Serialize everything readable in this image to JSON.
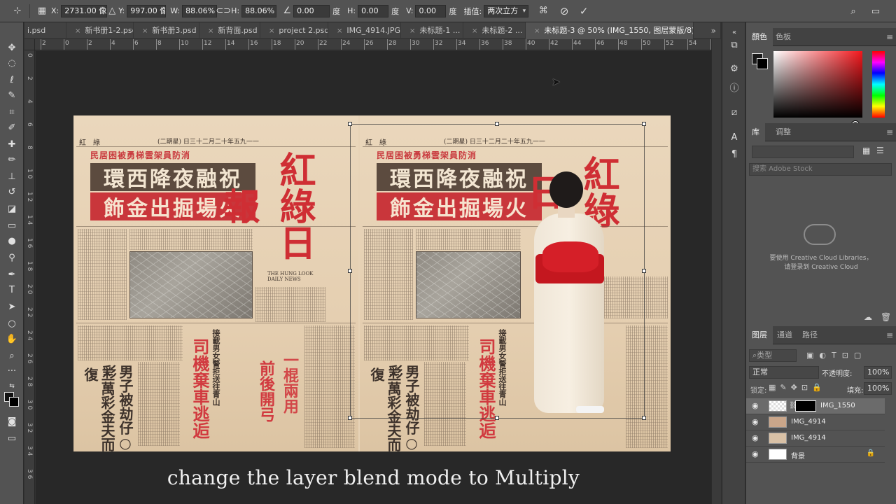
{
  "options_bar": {
    "x_label": "X:",
    "x_value": "2731.00 像素",
    "y_label": "Y:",
    "y_value": "997.00 像素",
    "w_label": "W:",
    "w_value": "88.06%",
    "h_label": "H:",
    "h_value": "88.06%",
    "angle_value": "0.00",
    "angle_unit": "度",
    "skew_h_label": "H:",
    "skew_h_value": "0.00",
    "skew_h_unit": "度",
    "skew_v_label": "V:",
    "skew_v_value": "0.00",
    "skew_v_unit": "度",
    "interp_label": "插值:",
    "interp_value": "两次立方"
  },
  "tabs": [
    {
      "label": "i.psd"
    },
    {
      "label": "新书册1-2.psd"
    },
    {
      "label": "新书册3.psd"
    },
    {
      "label": "新背面.psd"
    },
    {
      "label": "project 2.psd"
    },
    {
      "label": "IMG_4914.JPG"
    },
    {
      "label": "未标题-1 ..."
    },
    {
      "label": "未标题-2 ..."
    },
    {
      "label": "未标题-3 @ 50% (IMG_1550, 图层蒙版/8) *"
    }
  ],
  "tab_overflow": "»",
  "ruler": {
    "top_labels": [
      "2",
      "0",
      "2",
      "4",
      "6",
      "8",
      "10",
      "12",
      "14",
      "16",
      "18",
      "20",
      "22",
      "24",
      "26",
      "28",
      "30",
      "32",
      "34",
      "36",
      "38",
      "40",
      "42",
      "44",
      "46",
      "48",
      "50",
      "52",
      "54",
      "56"
    ],
    "left_labels": [
      "0",
      "2",
      "4",
      "6",
      "8",
      "1 0",
      "1 2",
      "1 4",
      "1 6",
      "1 8",
      "2 0",
      "2 2",
      "2 4",
      "2 6",
      "2 8",
      "3 0",
      "3 2",
      "3 4",
      "3 6"
    ]
  },
  "newspaper": {
    "masthead": "紅綠日報",
    "masthead_left": "紅綠日",
    "masthead_right": "紅綠日",
    "masthead_right_last": "報",
    "top_right_header": "紅　綠",
    "date_header": "(二期星)  日三十二月二十年五九一一",
    "headline_top": "民居困被勇梯雲架員防消",
    "headline_1": "環西降夜融祝",
    "headline_2": "飾金出掘場火",
    "red_vertical_1": "司機棄車逃逅",
    "red_vertical_2": "前後開弓",
    "red_vertical_3": "一棍兩用",
    "black_vertical_1": "男子被劫仔○彩",
    "black_vertical_2": "三萬彩金夫而復",
    "small_vertical": "接載男女警拒送往青山",
    "daily_news": "THE HUNG LOOK DAILY NEWS"
  },
  "subtitle": "change the layer blend mode to Multiply",
  "color_panel": {
    "tab_color": "顏色",
    "tab_swatches": "色板"
  },
  "library_panel": {
    "tab_library": "库",
    "tab_adjust": "调整",
    "search_placeholder": "搜索 Adobe Stock",
    "cc_msg_1": "要使用 Creative Cloud Libraries，",
    "cc_msg_2": "请登录到 Creative Cloud"
  },
  "layers_panel": {
    "tab_layers": "图层",
    "tab_channels": "通道",
    "tab_paths": "路径",
    "filter_label": "类型",
    "blend_mode": "正常",
    "opacity_label": "不透明度:",
    "opacity_value": "100%",
    "lock_label": "锁定:",
    "fill_label": "填充:",
    "fill_value": "100%",
    "layers": [
      {
        "name": "IMG_1550"
      },
      {
        "name": "IMG_4914"
      },
      {
        "name": "IMG_4914"
      },
      {
        "name": "背景"
      }
    ]
  }
}
